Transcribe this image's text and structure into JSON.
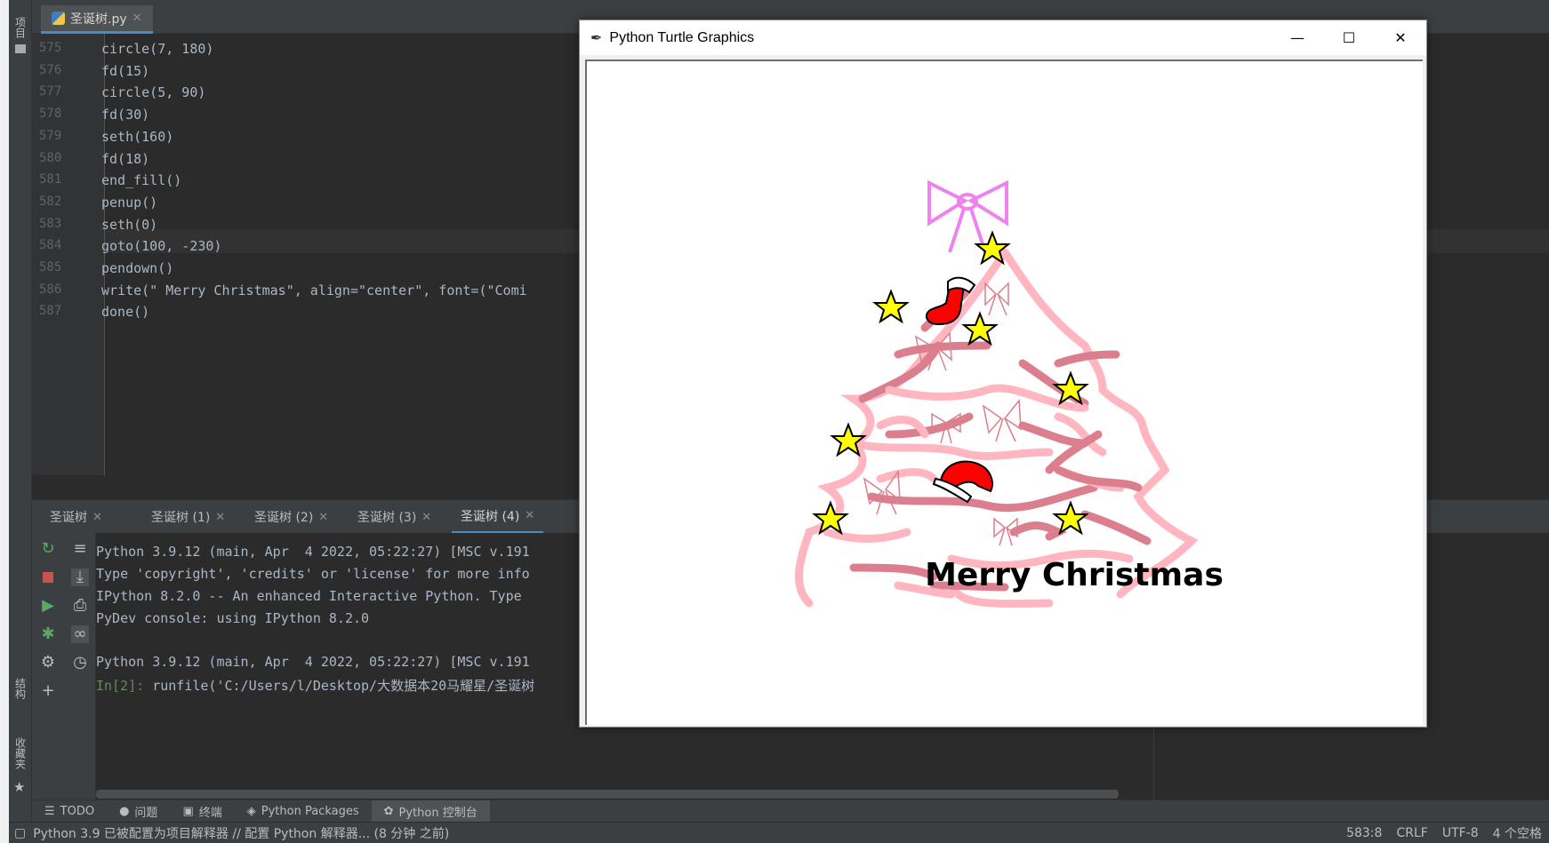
{
  "left_strip": {
    "project_label": "项目",
    "structure_label": "结构",
    "bookmarks_label": "收藏夹"
  },
  "editor": {
    "file_tab": "圣诞树.py",
    "lines": [
      {
        "n": "575",
        "code": "circle(7, 180)"
      },
      {
        "n": "576",
        "code": "fd(15)"
      },
      {
        "n": "577",
        "code": "circle(5, 90)"
      },
      {
        "n": "578",
        "code": "fd(30)"
      },
      {
        "n": "579",
        "code": "seth(160)"
      },
      {
        "n": "580",
        "code": "fd(18)"
      },
      {
        "n": "581",
        "code": "end_fill()"
      },
      {
        "n": "582",
        "code": "penup()"
      },
      {
        "n": "583",
        "code": "seth(0)"
      },
      {
        "n": "584",
        "code": "goto(100, -230)"
      },
      {
        "n": "585",
        "code": "pendown()"
      },
      {
        "n": "586",
        "code": "write(\" Merry Christmas\", align=\"center\", font=(\"Comi"
      },
      {
        "n": "587",
        "code": "done()"
      }
    ]
  },
  "console_tabs": [
    "圣诞树",
    "圣诞树 (1)",
    "圣诞树 (2)",
    "圣诞树 (3)",
    "圣诞树 (4)"
  ],
  "console": {
    "lines": [
      "Python 3.9.12 (main, Apr  4 2022, 05:22:27) [MSC v.191",
      "Type 'copyright', 'credits' or 'license' for more info",
      "IPython 8.2.0 -- An enhanced Interactive Python. Type",
      "PyDev console: using IPython 8.2.0",
      "",
      "Python 3.9.12 (main, Apr  4 2022, 05:22:27) [MSC v.191"
    ],
    "prompt": "In[2]:",
    "command": " runfile('C:/Users/l/Desktop/大数据本20马耀星/圣诞树"
  },
  "bottom_tabs": [
    {
      "icon": "list-icon",
      "label": "TODO"
    },
    {
      "icon": "problems-icon",
      "label": "问题"
    },
    {
      "icon": "terminal-icon",
      "label": "终端"
    },
    {
      "icon": "packages-icon",
      "label": "Python Packages"
    },
    {
      "icon": "python-console-icon",
      "label": "Python 控制台"
    }
  ],
  "status": {
    "message": "Python 3.9 已被配置为项目解释器 // 配置 Python 解释器... (8 分钟 之前)",
    "position": "583:8",
    "line_sep": "CRLF",
    "encoding": "UTF-8",
    "indent": "4 个空格"
  },
  "turtle_window": {
    "title": "Python Turtle Graphics",
    "minimize": "—",
    "maximize": "☐",
    "close": "✕",
    "greeting": "Merry Christmas"
  },
  "colors": {
    "accent": "#4a88c7",
    "tree_light": "#ffb6c1",
    "tree_dark": "#db7f8e",
    "bow": "#ee82ee",
    "star": "#ffff00",
    "red": "#ff0000"
  }
}
